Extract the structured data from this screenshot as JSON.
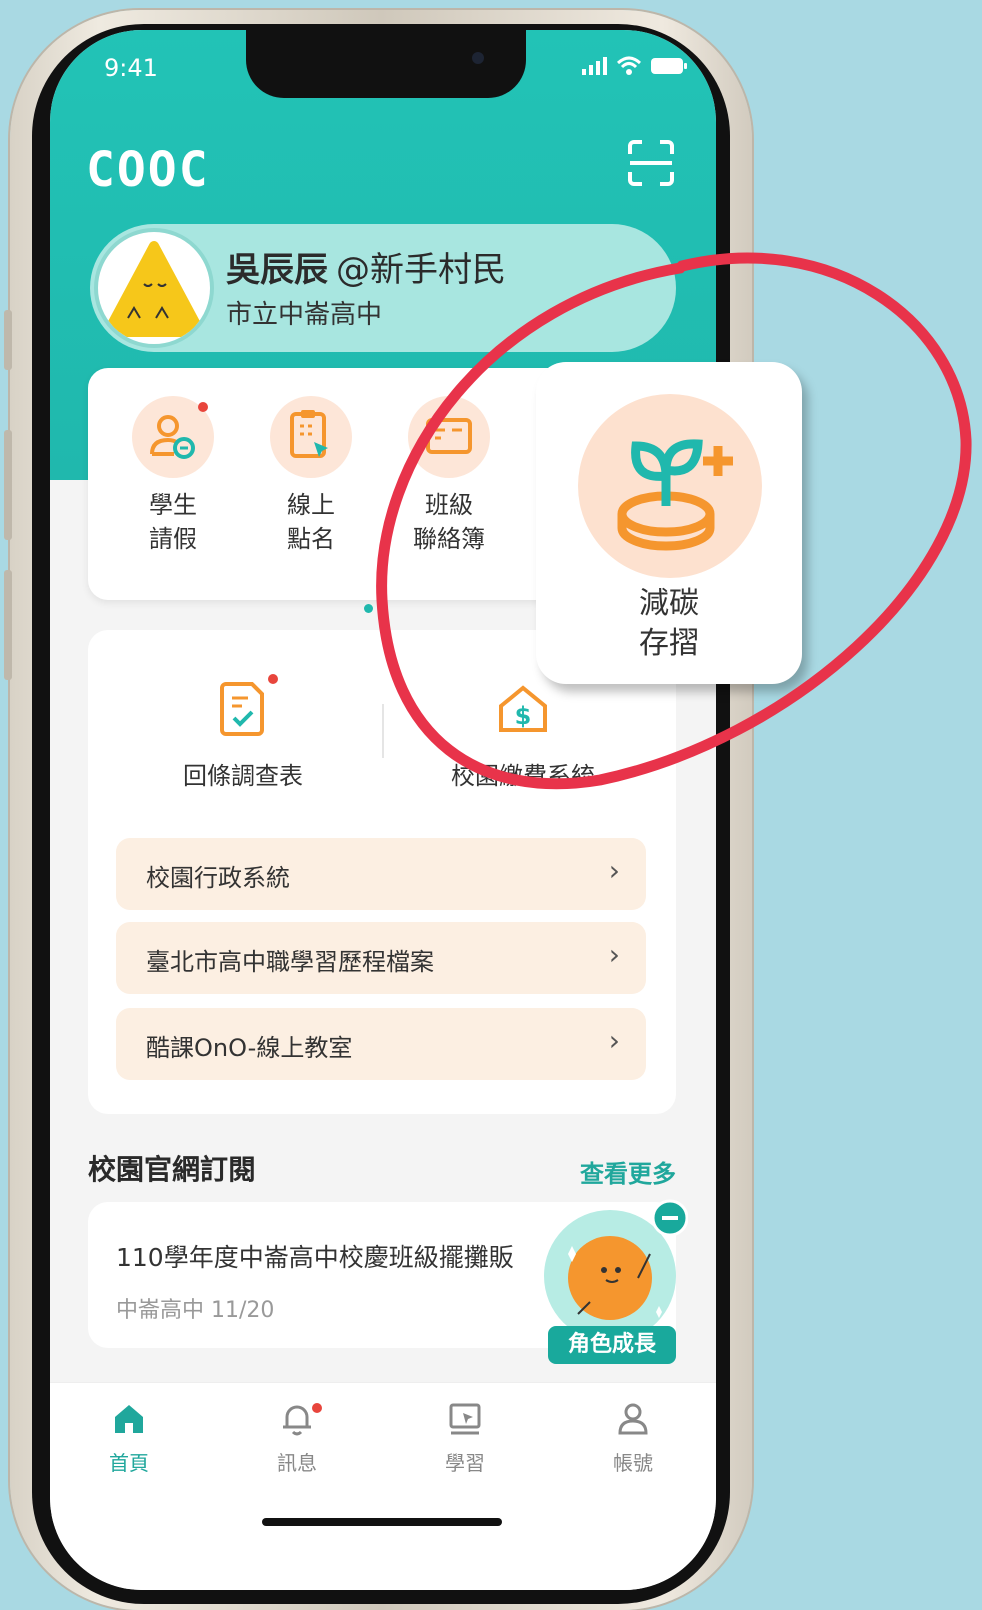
{
  "status_bar": {
    "time": "9:41"
  },
  "header": {
    "logo": "COOC"
  },
  "profile": {
    "name": "吳辰辰",
    "handle": "@新手村民",
    "school": "市立中崙高中"
  },
  "quick_actions": [
    {
      "label": "學生\n請假",
      "icon": "student-leave-icon",
      "badge": true
    },
    {
      "label": "線上\n點名",
      "icon": "online-rollcall-icon",
      "badge": false
    },
    {
      "label": "班級\n聯絡簿",
      "icon": "class-contact-book-icon",
      "badge": false
    }
  ],
  "highlight_popup": {
    "label": "減碳\n存摺",
    "icon": "carbon-passbook-icon"
  },
  "feature_items": [
    {
      "label": "回條調查表",
      "icon": "survey-form-icon",
      "badge": true
    },
    {
      "label": "校園繳費系統",
      "icon": "campus-payment-icon",
      "badge": false
    }
  ],
  "links": [
    {
      "label": "校園行政系統"
    },
    {
      "label": "臺北市高中職學習歷程檔案"
    },
    {
      "label": "酷課OnO-線上教室"
    }
  ],
  "subscription": {
    "title": "校園官網訂閱",
    "more": "查看更多",
    "news": {
      "title": "110學年度中崙高中校慶班級擺攤販",
      "meta": "中崙高中 11/20"
    }
  },
  "growth_widget": {
    "label": "角色成長"
  },
  "tabs": [
    {
      "label": "首頁",
      "icon": "home-icon",
      "active": true
    },
    {
      "label": "訊息",
      "icon": "bell-icon",
      "active": false,
      "badge": true
    },
    {
      "label": "學習",
      "icon": "learning-icon",
      "active": false
    },
    {
      "label": "帳號",
      "icon": "account-icon",
      "active": false
    }
  ],
  "colors": {
    "primary": "#20b8ad",
    "accent": "#f5962e",
    "annotation": "#e8334a",
    "background": "#a9d9e3"
  }
}
